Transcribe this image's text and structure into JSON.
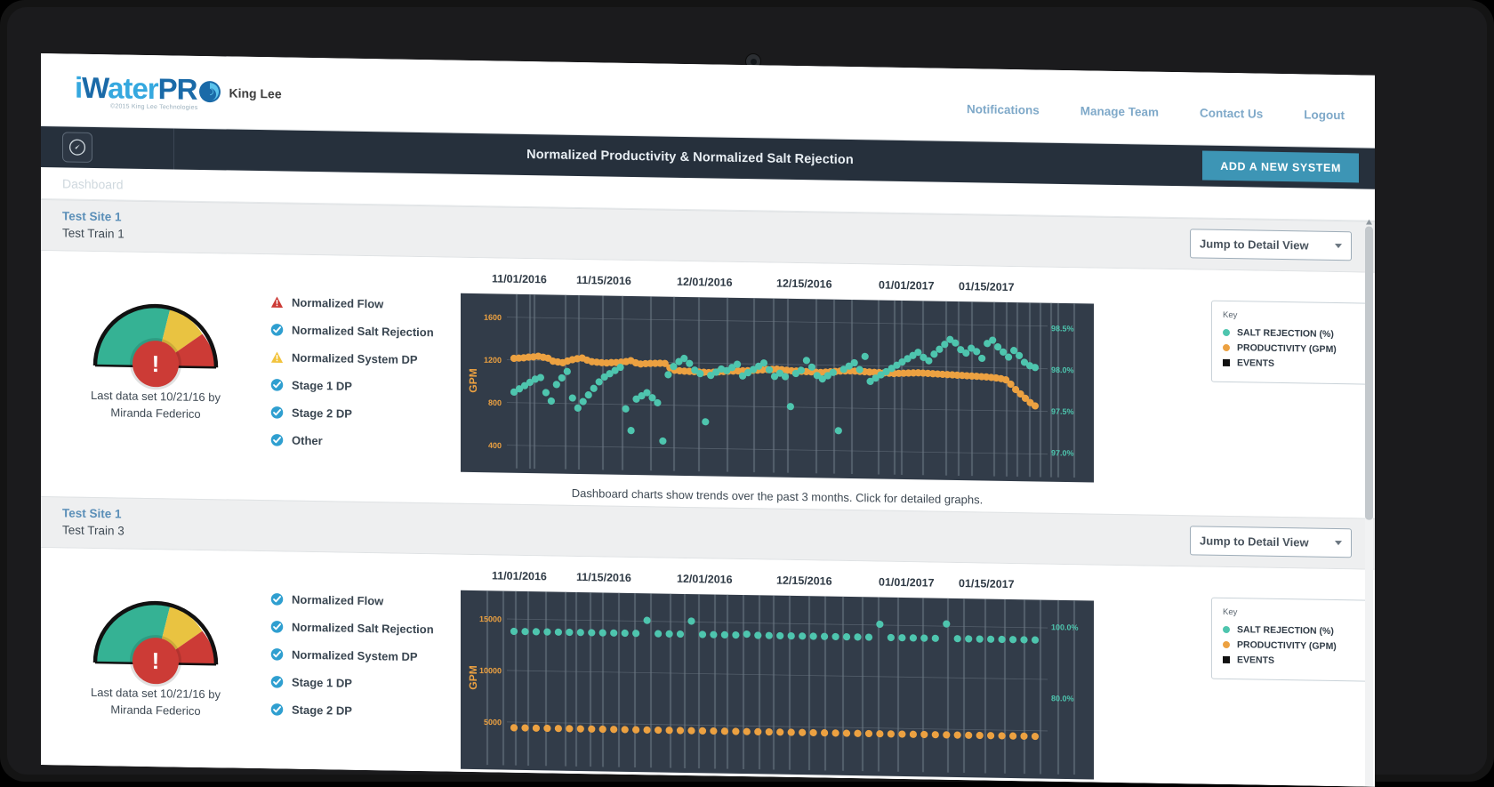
{
  "brand": {
    "logo_i": "i",
    "logo_w": "W",
    "logo_ater": "ater",
    "logo_pr": "PR",
    "swirl_icon": "swirl-icon",
    "copyright": "©2015 King Lee Technologies",
    "customer": "King Lee"
  },
  "topnav": {
    "items": [
      {
        "label": "Notifications",
        "name": "notifications"
      },
      {
        "label": "Manage Team",
        "name": "manage-team"
      },
      {
        "label": "Contact Us",
        "name": "contact-us"
      },
      {
        "label": "Logout",
        "name": "logout"
      }
    ]
  },
  "header": {
    "gauge_icon": "gauge-icon",
    "title": "Normalized Productivity & Normalized Salt Rejection",
    "add_system_label": "ADD A NEW SYSTEM"
  },
  "breadcrumb": {
    "label": "Dashboard"
  },
  "colors": {
    "accent_blue": "#3d95b5",
    "brand_blue": "#1a6aa8",
    "brand_cyan": "#35a8df",
    "dark_header": "#26303c",
    "chart_bg": "#323c49",
    "salt_rejection": "#4ec5ae",
    "productivity": "#eca141",
    "events": "#111111",
    "gauge_green": "#35b294",
    "gauge_yellow": "#e9c341",
    "gauge_red": "#cc3b36",
    "status_ok": "#2f9fd0",
    "status_warn": "#f2c33c",
    "status_alert": "#cc3b36"
  },
  "panels": [
    {
      "site": "Test Site 1",
      "train": "Test Train 1",
      "jump_label": "Jump to Detail View",
      "gauge": {
        "value_zone": "red",
        "badge": "!"
      },
      "gauge_caption_line1": "Last data set 10/21/16 by",
      "gauge_caption_line2": "Miranda Federico",
      "status_items": [
        {
          "label": "Normalized Flow",
          "state": "alert"
        },
        {
          "label": "Normalized Salt Rejection",
          "state": "ok"
        },
        {
          "label": "Normalized System DP",
          "state": "warn"
        },
        {
          "label": "Stage 1 DP",
          "state": "ok"
        },
        {
          "label": "Stage 2 DP",
          "state": "ok"
        },
        {
          "label": "Other",
          "state": "ok"
        }
      ],
      "footnote": "Dashboard charts show trends over the past 3 months. Click for detailed graphs.",
      "key": {
        "title": "Key",
        "items": [
          {
            "label": "SALT REJECTION (%)",
            "shape": "dot",
            "color": "#4ec5ae"
          },
          {
            "label": "PRODUCTIVITY (GPM)",
            "shape": "dot",
            "color": "#eca141"
          },
          {
            "label": "EVENTS",
            "shape": "square",
            "color": "#111111"
          }
        ]
      }
    },
    {
      "site": "Test Site 1",
      "train": "Test Train 3",
      "jump_label": "Jump to Detail View",
      "gauge": {
        "value_zone": "red",
        "badge": "!"
      },
      "gauge_caption_line1": "Last data set 10/21/16 by",
      "gauge_caption_line2": "Miranda Federico",
      "status_items": [
        {
          "label": "Normalized Flow",
          "state": "ok"
        },
        {
          "label": "Normalized Salt Rejection",
          "state": "ok"
        },
        {
          "label": "Normalized System DP",
          "state": "ok"
        },
        {
          "label": "Stage 1 DP",
          "state": "ok"
        },
        {
          "label": "Stage 2 DP",
          "state": "ok"
        }
      ],
      "footnote": "",
      "key": {
        "title": "Key",
        "items": [
          {
            "label": "SALT REJECTION (%)",
            "shape": "dot",
            "color": "#4ec5ae"
          },
          {
            "label": "PRODUCTIVITY (GPM)",
            "shape": "dot",
            "color": "#eca141"
          },
          {
            "label": "EVENTS",
            "shape": "square",
            "color": "#111111"
          }
        ]
      }
    }
  ],
  "chart_data": [
    {
      "type": "scatter",
      "title": "Normalized Productivity & Normalized Salt Rejection",
      "xlabel": "",
      "ylabel": "GPM",
      "y2label": "",
      "grid": true,
      "legend_position": "right",
      "x_tick_labels": [
        "11/01/2016",
        "11/15/2016",
        "12/01/2016",
        "12/15/2016",
        "01/01/2017",
        "01/15/2017"
      ],
      "y_ticks": [
        400,
        800,
        1200,
        1600
      ],
      "ylim": [
        300,
        1700
      ],
      "y2_ticks": [
        "97.0%",
        "97.5%",
        "98.0%",
        "98.5%"
      ],
      "y2lim": [
        96.85,
        98.65
      ],
      "series": [
        {
          "name": "PRODUCTIVITY (GPM)",
          "color": "#eca141",
          "axis": "left",
          "values": [
            1215,
            1218,
            1222,
            1228,
            1232,
            1238,
            1230,
            1222,
            1195,
            1188,
            1182,
            1198,
            1212,
            1222,
            1228,
            1210,
            1196,
            1192,
            1188,
            1186,
            1190,
            1192,
            1196,
            1202,
            1212,
            1192,
            1182,
            1186,
            1188,
            1190,
            1192,
            1190,
            1150,
            1128,
            1124,
            1122,
            1120,
            1118,
            1116,
            1114,
            1112,
            1116,
            1120,
            1124,
            1128,
            1130,
            1132,
            1134,
            1136,
            1140,
            1142,
            1146,
            1150,
            1152,
            1154,
            1150,
            1146,
            1142,
            1140,
            1138,
            1136,
            1134,
            1132,
            1130,
            1134,
            1138,
            1142,
            1146,
            1148,
            1150,
            1148,
            1146,
            1144,
            1142,
            1140,
            1138,
            1136,
            1134,
            1132,
            1134,
            1136,
            1138,
            1140,
            1142,
            1140,
            1138,
            1136,
            1134,
            1132,
            1130,
            1128,
            1126,
            1124,
            1122,
            1120,
            1118,
            1116,
            1114,
            1110,
            1106,
            1100,
            1090,
            1050,
            1000,
            960,
            920,
            880,
            850
          ]
        },
        {
          "name": "SALT REJECTION (%)",
          "color": "#4ec5ae",
          "axis": "right",
          "values": [
            97.62,
            97.66,
            97.7,
            97.74,
            97.78,
            97.8,
            97.62,
            97.52,
            97.72,
            97.8,
            97.88,
            97.56,
            97.44,
            97.52,
            97.6,
            97.68,
            97.76,
            97.82,
            97.86,
            97.9,
            97.94,
            97.44,
            97.18,
            97.56,
            97.6,
            97.64,
            97.58,
            97.52,
            97.06,
            97.86,
            97.96,
            98.02,
            98.06,
            98.0,
            97.92,
            97.88,
            97.3,
            97.86,
            97.9,
            97.94,
            97.92,
            97.96,
            98.0,
            97.86,
            97.9,
            97.94,
            97.98,
            98.02,
            97.94,
            97.86,
            97.9,
            97.86,
            97.5,
            97.9,
            97.94,
            98.06,
            97.98,
            97.88,
            97.84,
            97.88,
            97.92,
            97.22,
            97.96,
            98.0,
            98.04,
            97.96,
            98.12,
            97.82,
            97.86,
            97.9,
            97.94,
            97.98,
            98.02,
            98.06,
            98.1,
            98.14,
            98.18,
            98.12,
            98.08,
            98.16,
            98.22,
            98.28,
            98.34,
            98.3,
            98.22,
            98.18,
            98.24,
            98.2,
            98.12,
            98.3,
            98.34,
            98.26,
            98.2,
            98.14,
            98.22,
            98.16,
            98.08,
            98.04,
            98.02
          ]
        }
      ],
      "events_count": 28
    },
    {
      "type": "scatter",
      "title": "Normalized Productivity & Normalized Salt Rejection",
      "xlabel": "",
      "ylabel": "GPM",
      "grid": true,
      "legend_position": "right",
      "x_tick_labels": [
        "11/01/2016",
        "11/15/2016",
        "12/01/2016",
        "12/15/2016",
        "01/01/2017",
        "01/15/2017"
      ],
      "y_ticks": [
        5000,
        10000,
        15000
      ],
      "ylim": [
        2000,
        16500
      ],
      "y2_ticks": [
        "80.0%",
        "100.0%"
      ],
      "y2lim": [
        62.0,
        104.0
      ],
      "series": [
        {
          "name": "SALT REJECTION (%)",
          "color": "#4ec5ae",
          "axis": "right",
          "values": [
            96.2,
            96.2,
            96.2,
            96.2,
            96.2,
            96.2,
            96.2,
            96.2,
            96.2,
            96.2,
            96.2,
            96.2,
            99.9,
            96.2,
            96.2,
            96.2,
            99.9,
            96.2,
            96.2,
            96.2,
            96.2,
            96.5,
            96.2,
            96.2,
            96.2,
            96.2,
            96.2,
            96.2,
            96.2,
            96.2,
            96.2,
            96.2,
            96.2,
            99.9,
            96.2,
            96.2,
            96.2,
            96.2,
            96.2,
            100.3,
            96.2,
            96.2,
            96.2,
            96.2,
            96.2,
            96.2,
            96.2,
            96.2
          ]
        },
        {
          "name": "PRODUCTIVITY (GPM)",
          "color": "#eca141",
          "axis": "left",
          "values": [
            4450,
            4450,
            4450,
            4450,
            4450,
            4450,
            4450,
            4450,
            4450,
            4450,
            4450,
            4450,
            4450,
            4450,
            4450,
            4450,
            4450,
            4450,
            4450,
            4450,
            4450,
            4450,
            4450,
            4450,
            4450,
            4450,
            4450,
            4450,
            4450,
            4450,
            4450,
            4450,
            4450,
            4450,
            4450,
            4450,
            4450,
            4450,
            4450,
            4450,
            4450,
            4450,
            4450,
            4450,
            4450,
            4450,
            4450,
            4450
          ]
        }
      ],
      "events_count": 30
    }
  ]
}
